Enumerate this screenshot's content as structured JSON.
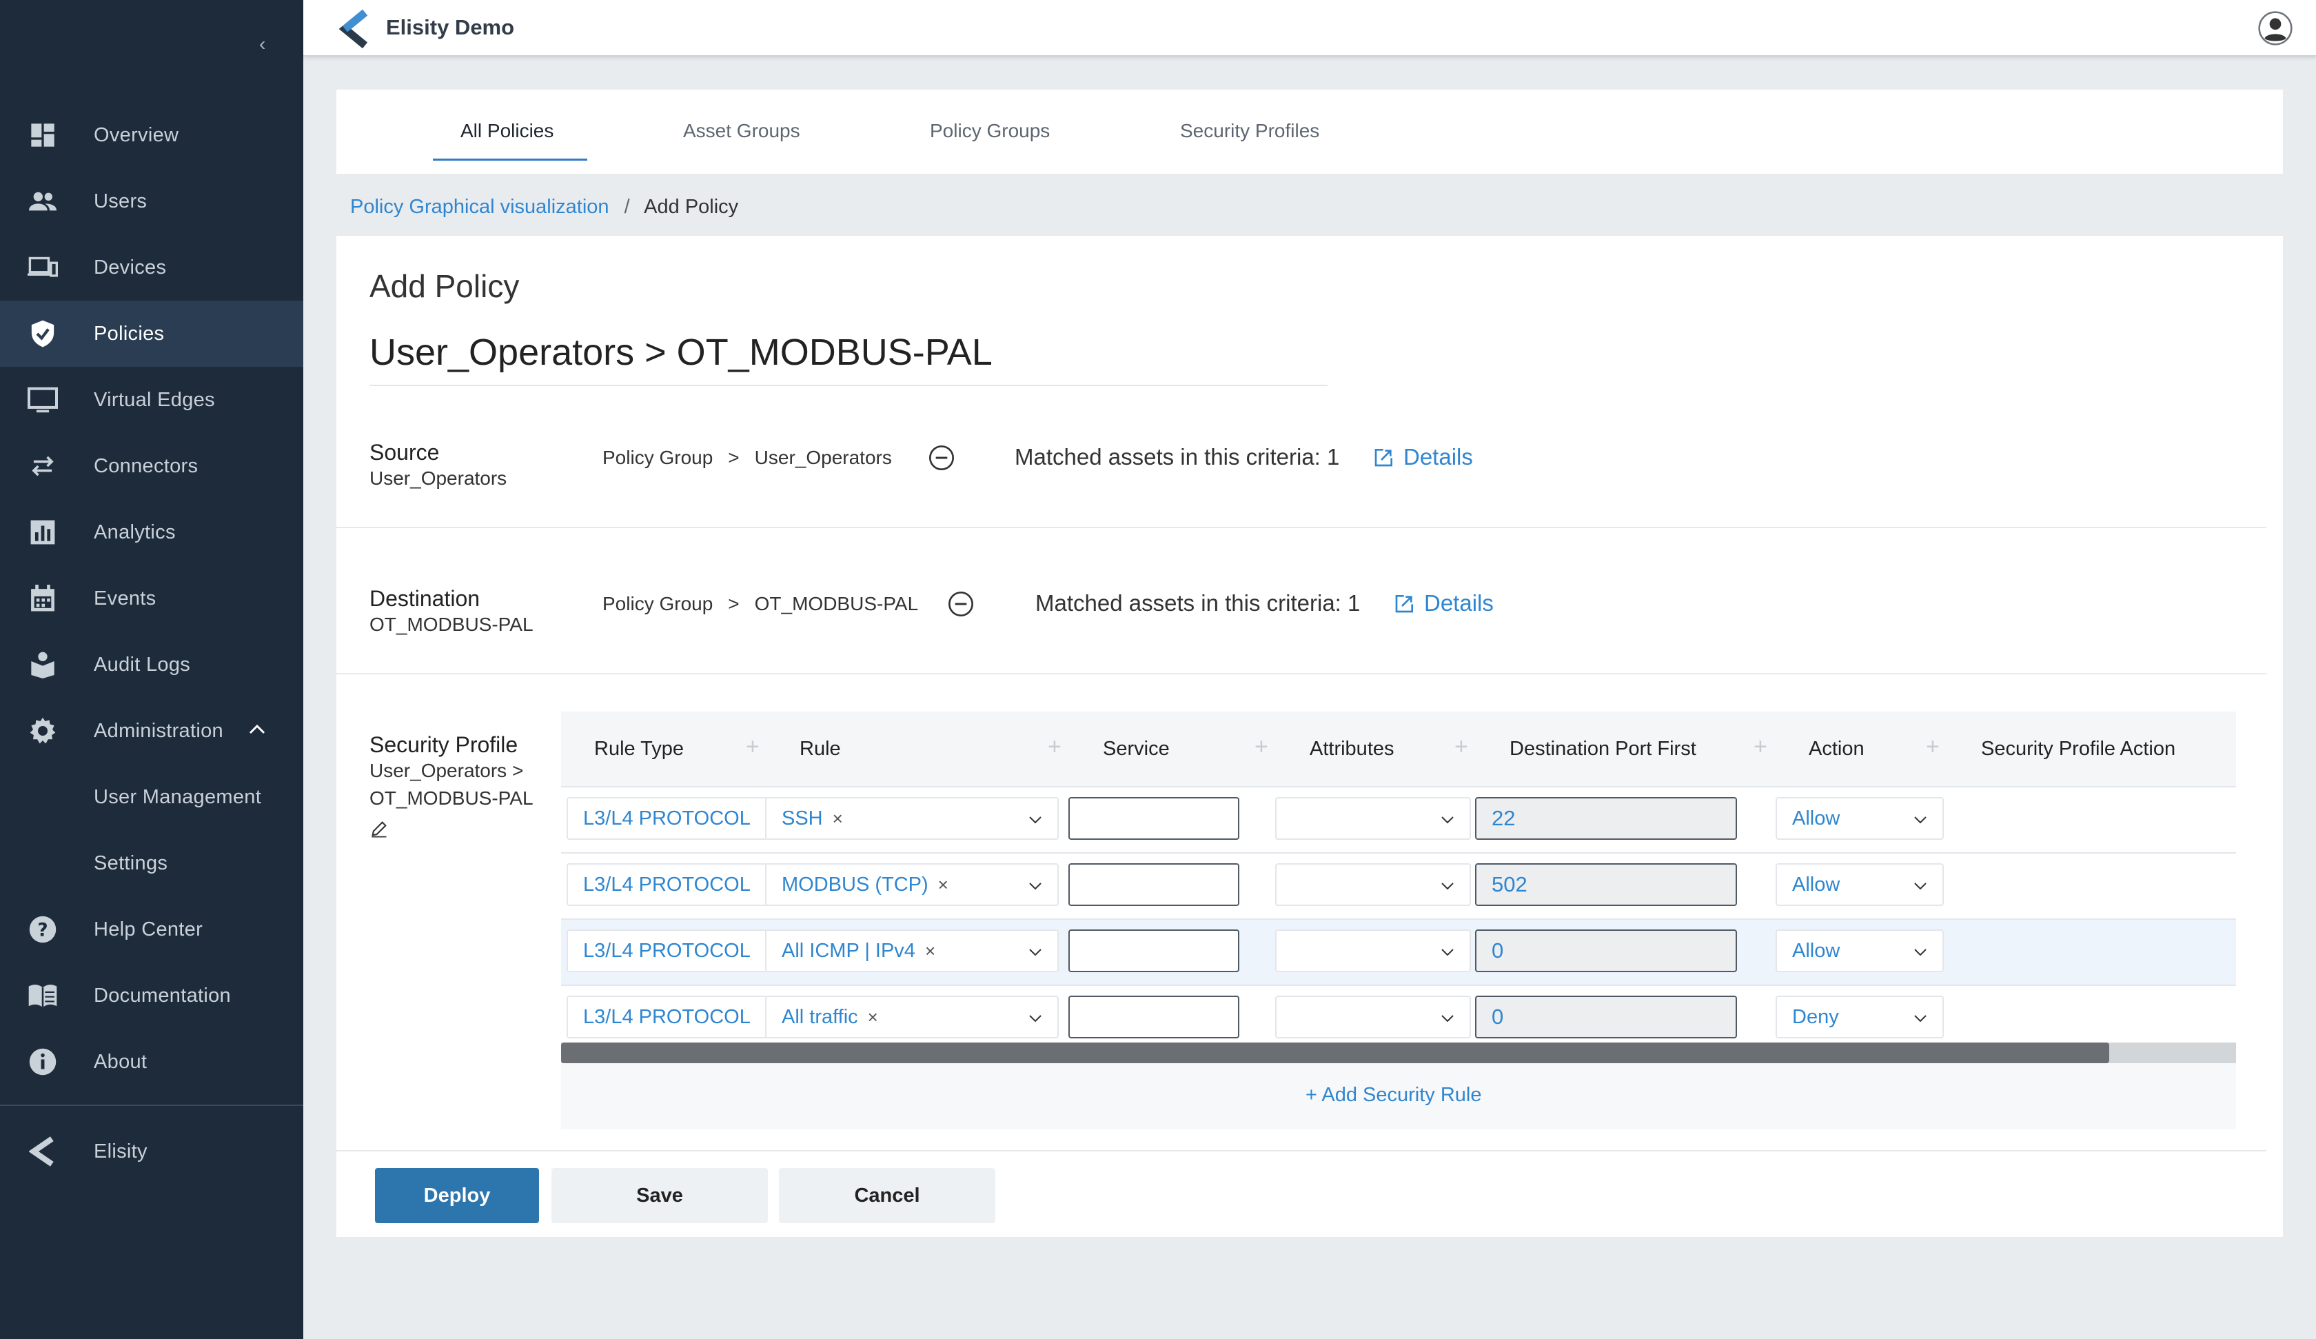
{
  "app": {
    "title": "Elisity Demo"
  },
  "sidebar": {
    "collapse": "‹",
    "items": [
      {
        "label": "Overview",
        "icon": "grid-icon"
      },
      {
        "label": "Users",
        "icon": "users-icon"
      },
      {
        "label": "Devices",
        "icon": "devices-icon"
      },
      {
        "label": "Policies",
        "icon": "shield-icon"
      },
      {
        "label": "Virtual Edges",
        "icon": "monitor-icon"
      },
      {
        "label": "Connectors",
        "icon": "arrows-icon"
      },
      {
        "label": "Analytics",
        "icon": "analytics-icon"
      },
      {
        "label": "Events",
        "icon": "calendar-icon"
      },
      {
        "label": "Audit Logs",
        "icon": "audit-icon"
      },
      {
        "label": "Administration",
        "icon": "gear-icon"
      },
      {
        "label": "User Management"
      },
      {
        "label": "Settings"
      },
      {
        "label": "Help Center",
        "icon": "help-icon"
      },
      {
        "label": "Documentation",
        "icon": "book-icon"
      },
      {
        "label": "About",
        "icon": "info-icon"
      },
      {
        "label": "Elisity",
        "icon": "elisity-logo-icon"
      }
    ],
    "active": "Policies"
  },
  "tabs": [
    "All Policies",
    "Asset Groups",
    "Policy Groups",
    "Security Profiles"
  ],
  "breadcrumb": {
    "link": "Policy Graphical visualization",
    "sep": "/",
    "current": "Add Policy"
  },
  "policy": {
    "heading": "Add Policy",
    "name": "User_Operators > OT_MODBUS-PAL",
    "source": {
      "title": "Source",
      "value": "User_Operators",
      "criteria_type": "Policy Group",
      "criteria_arrow": ">",
      "criteria_value": "User_Operators",
      "matched": "Matched assets in this criteria: 1",
      "details": "Details"
    },
    "destination": {
      "title": "Destination",
      "value": "OT_MODBUS-PAL",
      "criteria_type": "Policy Group",
      "criteria_arrow": ">",
      "criteria_value": "OT_MODBUS-PAL",
      "matched": "Matched assets in this criteria: 1",
      "details": "Details"
    },
    "security_profile": {
      "title": "Security Profile",
      "line1": "User_Operators >",
      "line2": "OT_MODBUS-PAL"
    }
  },
  "table": {
    "columns": [
      "Rule Type",
      "Rule",
      "Service",
      "Attributes",
      "Destination Port First",
      "Action",
      "Security Profile Action"
    ],
    "rows": [
      {
        "rule_type": "L3/L4 PROTOCOL",
        "rule": "SSH",
        "service": "",
        "attributes": "",
        "port": "22",
        "action": "Allow"
      },
      {
        "rule_type": "L3/L4 PROTOCOL",
        "rule": "MODBUS (TCP)",
        "service": "",
        "attributes": "",
        "port": "502",
        "action": "Allow"
      },
      {
        "rule_type": "L3/L4 PROTOCOL",
        "rule": "All ICMP | IPv4",
        "service": "",
        "attributes": "",
        "port": "0",
        "action": "Allow"
      },
      {
        "rule_type": "L3/L4 PROTOCOL",
        "rule": "All traffic",
        "service": "",
        "attributes": "",
        "port": "0",
        "action": "Deny"
      }
    ],
    "remove_glyph": "×",
    "add_rule": "+  Add Security Rule"
  },
  "buttons": {
    "deploy": "Deploy",
    "save": "Save",
    "cancel": "Cancel"
  },
  "colors": {
    "sidebar": "#1d2b3a",
    "accent": "#2f86d0",
    "primary_button": "#2c75ad"
  }
}
